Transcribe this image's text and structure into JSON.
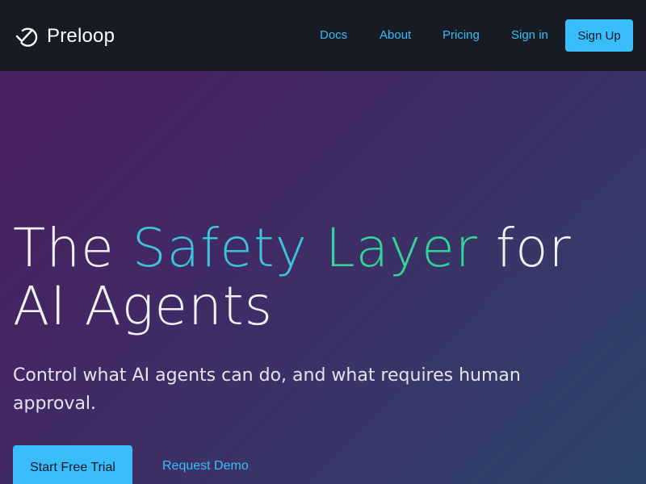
{
  "header": {
    "brand_name": "Preloop",
    "logo_icon": "check-loop-icon",
    "nav": {
      "docs": "Docs",
      "about": "About",
      "pricing": "Pricing",
      "sign_in": "Sign in"
    },
    "sign_up_label": "Sign Up"
  },
  "hero": {
    "headline_part1": "The ",
    "headline_highlight1": "Safety",
    "headline_space": " ",
    "headline_highlight2": "Layer",
    "headline_part2": " for AI Agents",
    "subtitle": "Control what AI agents can do, and what requires human approval.",
    "primary_cta": "Start Free Trial",
    "secondary_cta": "Request Demo"
  },
  "colors": {
    "accent": "#38bdf8",
    "highlight_blue": "#3ec3d8",
    "highlight_green": "#34d399",
    "header_bg": "#161b24"
  }
}
